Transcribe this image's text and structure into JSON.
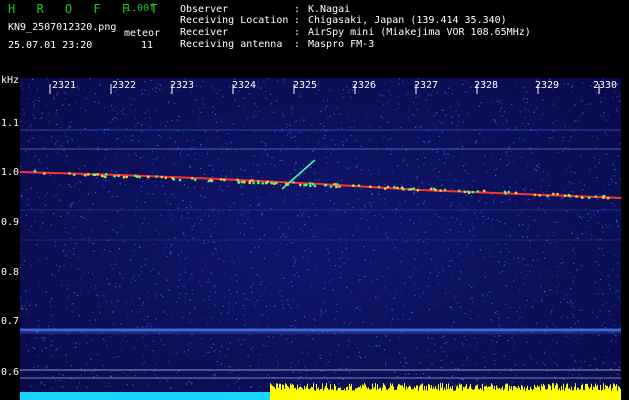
{
  "header": {
    "app_title": "H R O F F T",
    "version": "1.00f",
    "filename": "KN9_2507012320.png",
    "mode": "meteor",
    "datetime": "25.07.01 23:20",
    "count": "11"
  },
  "meta": [
    {
      "label": "Observer",
      "value": "K.Nagai"
    },
    {
      "label": "Receiving Location",
      "value": "Chigasaki, Japan (139.414 35.340)"
    },
    {
      "label": "Receiver",
      "value": "AirSpy mini (Miakejima VOR 108.65MHz)"
    },
    {
      "label": "Receiving antenna",
      "value": "Maspro FM-3"
    }
  ],
  "axis": {
    "unit": "kHz",
    "x_ticks": [
      "2321",
      "2322",
      "2323",
      "2324",
      "2325",
      "2326",
      "2327",
      "2328",
      "2329",
      "2330"
    ],
    "y_ticks": [
      "1.1",
      "1.0",
      "0.9",
      "0.8",
      "0.7",
      "0.6"
    ]
  },
  "colors": {
    "background": "#0b0f5c",
    "trace": "#ff3030",
    "cyan_bar": "#19d6ff",
    "yellow_bar": "#ffff00"
  }
}
